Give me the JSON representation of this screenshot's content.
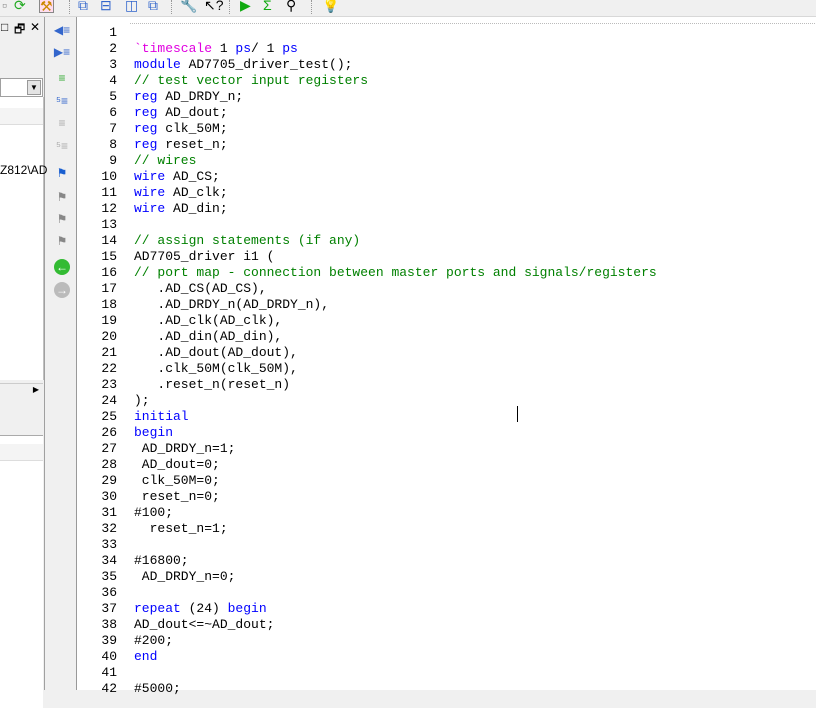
{
  "toolbar": {
    "icons": [
      "refresh-icon",
      "build-icon",
      "cascade-windows-icon",
      "tile-horizontal-icon",
      "tile-vertical-icon",
      "arrange-icon",
      "wrench-icon",
      "context-help-icon",
      "run-icon",
      "sigma-icon",
      "telescope-icon",
      "lightbulb-icon"
    ]
  },
  "left_panel": {
    "path_fragment": "Z812\\AD",
    "window_controls": [
      "□",
      "🗗",
      "✕"
    ]
  },
  "editor": {
    "lines": [
      [],
      [
        [
          "`timescale",
          "dir"
        ],
        [
          " 1 ",
          "tx"
        ],
        [
          "ps",
          "kw"
        ],
        [
          "/ 1 ",
          "tx"
        ],
        [
          "ps",
          "kw"
        ]
      ],
      [
        [
          "module",
          "kw"
        ],
        [
          " AD7705_driver_test();",
          "tx"
        ]
      ],
      [
        [
          "// test vector input registers",
          "cm"
        ]
      ],
      [
        [
          "reg",
          "kw"
        ],
        [
          " AD_DRDY_n;",
          "tx"
        ]
      ],
      [
        [
          "reg",
          "kw"
        ],
        [
          " AD_dout;",
          "tx"
        ]
      ],
      [
        [
          "reg",
          "kw"
        ],
        [
          " clk_50M;",
          "tx"
        ]
      ],
      [
        [
          "reg",
          "kw"
        ],
        [
          " reset_n;",
          "tx"
        ]
      ],
      [
        [
          "// wires",
          "cm"
        ]
      ],
      [
        [
          "wire",
          "kw"
        ],
        [
          " AD_CS;",
          "tx"
        ]
      ],
      [
        [
          "wire",
          "kw"
        ],
        [
          " AD_clk;",
          "tx"
        ]
      ],
      [
        [
          "wire",
          "kw"
        ],
        [
          " AD_din;",
          "tx"
        ]
      ],
      [],
      [
        [
          "// assign statements (if any)",
          "cm"
        ]
      ],
      [
        [
          "AD7705_driver i1 (",
          "tx"
        ]
      ],
      [
        [
          "// port map - connection between master ports and signals/registers",
          "cm"
        ]
      ],
      [
        [
          "   .AD_CS(AD_CS),",
          "tx"
        ]
      ],
      [
        [
          "   .AD_DRDY_n(AD_DRDY_n),",
          "tx"
        ]
      ],
      [
        [
          "   .AD_clk(AD_clk),",
          "tx"
        ]
      ],
      [
        [
          "   .AD_din(AD_din),",
          "tx"
        ]
      ],
      [
        [
          "   .AD_dout(AD_dout),",
          "tx"
        ]
      ],
      [
        [
          "   .clk_50M(clk_50M),",
          "tx"
        ]
      ],
      [
        [
          "   .reset_n(reset_n)",
          "tx"
        ]
      ],
      [
        [
          ");",
          "tx"
        ]
      ],
      [
        [
          "initial",
          "kw"
        ]
      ],
      [
        [
          "begin",
          "kw"
        ]
      ],
      [
        [
          " AD_DRDY_n=1;",
          "tx"
        ]
      ],
      [
        [
          " AD_dout=0;",
          "tx"
        ]
      ],
      [
        [
          " clk_50M=0;",
          "tx"
        ]
      ],
      [
        [
          " reset_n=0;",
          "tx"
        ]
      ],
      [
        [
          "#100;",
          "tx"
        ]
      ],
      [
        [
          "  reset_n=1;",
          "tx"
        ]
      ],
      [],
      [
        [
          "#16800;",
          "tx"
        ]
      ],
      [
        [
          " AD_DRDY_n=0;",
          "tx"
        ]
      ],
      [],
      [
        [
          "repeat",
          "kw"
        ],
        [
          " (24) ",
          "tx"
        ],
        [
          "begin",
          "kw"
        ]
      ],
      [
        [
          "AD_dout<=~AD_dout;",
          "tx"
        ]
      ],
      [
        [
          "#200;",
          "tx"
        ]
      ],
      [
        [
          "end",
          "kw"
        ]
      ],
      [],
      [
        [
          "#5000;",
          "tx"
        ]
      ]
    ]
  }
}
